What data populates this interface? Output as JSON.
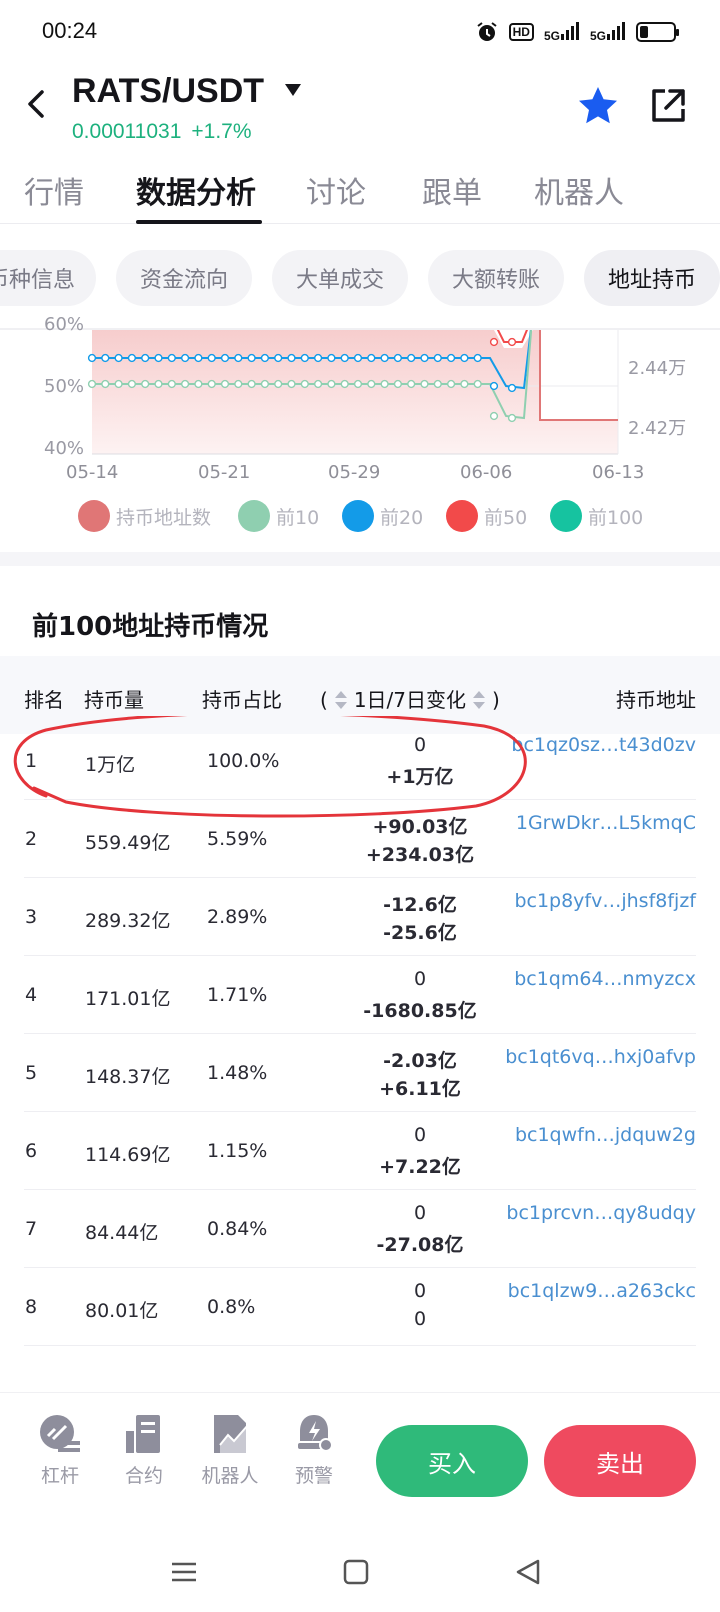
{
  "status": {
    "time": "00:24",
    "hd": "HD",
    "net1": "5G",
    "net2": "5G"
  },
  "header": {
    "pair": "RATS/USDT",
    "price": "0.00011031",
    "change": "+1.7%"
  },
  "main_tabs": [
    "行情",
    "数据分析",
    "讨论",
    "跟单",
    "机器人"
  ],
  "sub_tabs": [
    "币种信息",
    "资金流向",
    "大单成交",
    "大额转账",
    "地址持币"
  ],
  "chart": {
    "y_left_ticks": [
      "60%",
      "50%",
      "40%"
    ],
    "y_right_ticks": [
      "2.44万",
      "2.42万"
    ],
    "x_ticks": [
      "05-14",
      "05-21",
      "05-29",
      "06-06",
      "06-13"
    ]
  },
  "legend": [
    "持币地址数",
    "前10",
    "前20",
    "前50",
    "前100"
  ],
  "colors": {
    "holders": "#e07676",
    "top10": "#8fcfb0",
    "top20": "#139be8",
    "top50": "#f24a4a",
    "top100": "#16c3a0"
  },
  "section_title": "前100地址持币情况",
  "table": {
    "headers": {
      "rank": "排名",
      "amount": "持币量",
      "ratio": "持币占比",
      "change_open": "(",
      "change": "1日/7日变化",
      "change_close": ")",
      "address": "持币地址"
    },
    "rows": [
      {
        "rank": "1",
        "amount": "1万亿",
        "ratio": "100.0%",
        "d1": "0",
        "d7": "+1万亿",
        "address": "bc1qz0sz…t43d0zv"
      },
      {
        "rank": "2",
        "amount": "559.49亿",
        "ratio": "5.59%",
        "d1": "+90.03亿",
        "d7": "+234.03亿",
        "address": "1GrwDkr…L5kmqC"
      },
      {
        "rank": "3",
        "amount": "289.32亿",
        "ratio": "2.89%",
        "d1": "-12.6亿",
        "d7": "-25.6亿",
        "address": "bc1p8yfv…jhsf8fjzf"
      },
      {
        "rank": "4",
        "amount": "171.01亿",
        "ratio": "1.71%",
        "d1": "0",
        "d7": "-1680.85亿",
        "address": "bc1qm64…nmyzcx"
      },
      {
        "rank": "5",
        "amount": "148.37亿",
        "ratio": "1.48%",
        "d1": "-2.03亿",
        "d7": "+6.11亿",
        "address": "bc1qt6vq…hxj0afvp"
      },
      {
        "rank": "6",
        "amount": "114.69亿",
        "ratio": "1.15%",
        "d1": "0",
        "d7": "+7.22亿",
        "address": "bc1qwfn…jdquw2g"
      },
      {
        "rank": "7",
        "amount": "84.44亿",
        "ratio": "0.84%",
        "d1": "0",
        "d7": "-27.08亿",
        "address": "bc1prcvn…qy8udqy"
      },
      {
        "rank": "8",
        "amount": "80.01亿",
        "ratio": "0.8%",
        "d1": "0",
        "d7": "0",
        "address": "bc1qlzw9…a263ckc"
      }
    ]
  },
  "bottom_nav": [
    "杠杆",
    "合约",
    "机器人",
    "预警"
  ],
  "buy_label": "买入",
  "sell_label": "卖出",
  "battery_level": 0.25
}
